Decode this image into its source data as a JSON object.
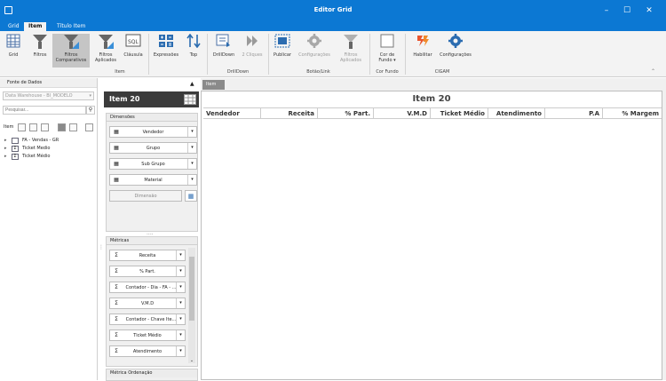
{
  "window": {
    "title": "Editor Grid"
  },
  "tabs": [
    {
      "label": "Grid",
      "active": false
    },
    {
      "label": "Item",
      "active": true
    },
    {
      "label": "Título Item",
      "active": false
    }
  ],
  "ribbon": {
    "buttons": [
      {
        "line1": "Grid",
        "line2": "",
        "icon": "grid-icon",
        "selected": false,
        "disabled": false
      },
      {
        "line1": "Filtros",
        "line2": "",
        "icon": "filter-icon",
        "selected": false,
        "disabled": false
      },
      {
        "line1": "Filtros",
        "line2": "Comparativos",
        "icon": "comparative-filter-icon",
        "selected": true,
        "disabled": false
      },
      {
        "line1": "Filtros",
        "line2": "Aplicados",
        "icon": "applied-filter-icon",
        "selected": false,
        "disabled": false
      },
      {
        "line1": "Cláusula",
        "line2": "",
        "icon": "sql-icon",
        "selected": false,
        "disabled": false
      },
      {
        "line1": "Expressões",
        "line2": "",
        "icon": "expressions-icon",
        "selected": false,
        "disabled": false
      },
      {
        "line1": "Top",
        "line2": "",
        "icon": "sort-icon",
        "selected": false,
        "disabled": false
      },
      {
        "line1": "DrillDown",
        "line2": "",
        "icon": "drilldown-icon",
        "selected": false,
        "disabled": false
      },
      {
        "line1": "2 Cliques",
        "line2": "",
        "icon": "double-click-icon",
        "selected": false,
        "disabled": true
      },
      {
        "line1": "Publicar",
        "line2": "",
        "icon": "publish-icon",
        "selected": false,
        "disabled": false
      },
      {
        "line1": "Configurações",
        "line2": "",
        "icon": "gear-icon",
        "selected": false,
        "disabled": true
      },
      {
        "line1": "Filtros",
        "line2": "Aplicados",
        "icon": "filter-icon",
        "selected": false,
        "disabled": true
      },
      {
        "line1": "Cor de",
        "line2": "Fundo ▾",
        "icon": "background-color-icon",
        "selected": false,
        "disabled": false
      },
      {
        "line1": "Habilitar",
        "line2": "",
        "icon": "enable-icon",
        "selected": false,
        "disabled": false
      },
      {
        "line1": "Configurações",
        "line2": "",
        "icon": "gear-icon",
        "selected": false,
        "disabled": false
      }
    ],
    "groups": [
      "Item",
      "DrillDown",
      "Botão/Link",
      "Cor Fundo",
      "CIGAM"
    ]
  },
  "left_panel": {
    "header": "Fonte de Dados",
    "datasource": "Data Warehouse - BI_MODELO",
    "search_placeholder": "Pesquisar...",
    "toolbar_label": "Item",
    "tree": [
      {
        "label": "FA - Vendas - GR",
        "icon": "table-icon"
      },
      {
        "label": "Ticket Medio",
        "icon": "sigma-icon"
      },
      {
        "label": "Ticket Médio",
        "icon": "sigma-icon"
      }
    ]
  },
  "item_panel": {
    "title": "Item 20",
    "dimensions_header": "Dimensões",
    "dimensions": [
      "Vendedor",
      "Grupo",
      "Sub Grupo",
      "Material"
    ],
    "dimension_placeholder": "Dimensão",
    "metrics_header": "Métricas",
    "metrics": [
      "Receita",
      "% Part.",
      "Contador - Dia - FA - ...",
      "V.M.D",
      "Contador - Chave Ite...",
      "Ticket Médio",
      "Atendimento"
    ],
    "metric_order_header": "Métrica Ordenação"
  },
  "grid": {
    "tab_label": "Item",
    "title": "Item 20",
    "columns": [
      "Vendedor",
      "Receita",
      "% Part.",
      "V.M.D",
      "Ticket Médio",
      "Atendimento",
      "P.A",
      "% Margem"
    ]
  },
  "colors": {
    "titlebar": "#0c78d3",
    "item_header": "#3b3b3b"
  }
}
